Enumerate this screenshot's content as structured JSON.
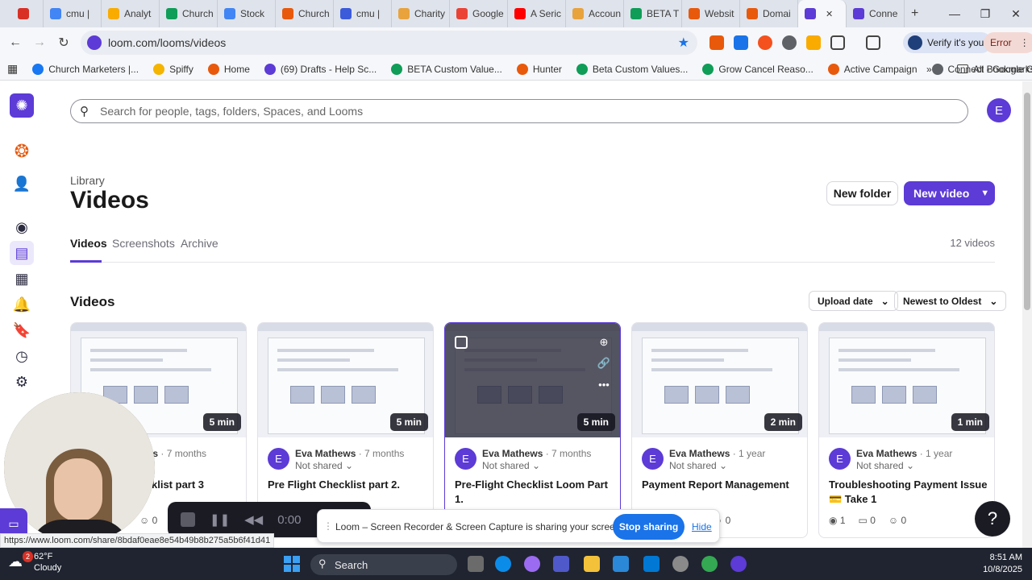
{
  "browser": {
    "tabs": [
      {
        "label": "",
        "color": "#d93025"
      },
      {
        "label": "cmu |",
        "color": "#4285f4"
      },
      {
        "label": "Analyt",
        "color": "#f9ab00"
      },
      {
        "label": "Church",
        "color": "#0f9d58"
      },
      {
        "label": "Stock",
        "color": "#4285f4"
      },
      {
        "label": "Church",
        "color": "#e8590c"
      },
      {
        "label": "cmu |",
        "color": "#3b5bdb"
      },
      {
        "label": "Charity",
        "color": "#e8a33d"
      },
      {
        "label": "Google",
        "color": "#ea4335"
      },
      {
        "label": "A Seric",
        "color": "#ff0000"
      },
      {
        "label": "Accoun",
        "color": "#e8a33d"
      },
      {
        "label": "BETA T",
        "color": "#0f9d58"
      },
      {
        "label": "Websit",
        "color": "#e8590c"
      },
      {
        "label": "Domai",
        "color": "#e8590c"
      },
      {
        "label": "",
        "color": "#5c3bd6"
      },
      {
        "label": "Conne",
        "color": "#5c3bd6"
      }
    ],
    "url": "loom.com/looms/videos",
    "verify_label": "Verify it's you",
    "error_label": "Error",
    "bookmarks": [
      {
        "label": "Church Marketers |...",
        "color": "#1877f2"
      },
      {
        "label": "Spiffy",
        "color": "#f4b400"
      },
      {
        "label": "Home",
        "color": "#e8590c"
      },
      {
        "label": "(69) Drafts - Help Sc...",
        "color": "#5c3bd6"
      },
      {
        "label": "BETA Custom Value...",
        "color": "#0f9d58"
      },
      {
        "label": "Hunter",
        "color": "#e8590c"
      },
      {
        "label": "Beta Custom Values...",
        "color": "#0f9d58"
      },
      {
        "label": "Grow Cancel Reaso...",
        "color": "#0f9d58"
      },
      {
        "label": "Active Campaign",
        "color": "#e8590c"
      },
      {
        "label": "Connect - Google G...",
        "color": "#5f6368"
      }
    ],
    "all_bookmarks": "All Bookmarks",
    "status_url": "https://www.loom.com/share/8bdaf0eae8e54b49b8b275a5b6f41d41"
  },
  "app": {
    "accent": "#5c3bd6",
    "search_placeholder": "Search for people, tags, folders, Spaces, and Looms",
    "avatar_initial": "E",
    "library_label": "Library",
    "page_title": "Videos",
    "new_folder": "New folder",
    "new_video": "New video",
    "tabs": [
      "Videos",
      "Screenshots",
      "Archive"
    ],
    "video_count": "12 videos",
    "section_title": "Videos",
    "sort_by": "Upload date",
    "sort_order": "Newest to Oldest",
    "videos": [
      {
        "title": "klist part 3",
        "author": "ws",
        "age": "· 7 months",
        "share": "",
        "duration": "5 min",
        "views": "",
        "comments": "",
        "reactions": "0"
      },
      {
        "title": "Pre Flight Checklist part 2.",
        "author": "Eva Mathews",
        "age": "· 7 months",
        "share": "Not shared",
        "duration": "5 min",
        "views": "",
        "comments": "",
        "reactions": ""
      },
      {
        "title": "Pre-Flight Checklist Loom Part 1.",
        "author": "Eva Mathews",
        "age": "· 7 months",
        "share": "Not shared",
        "duration": "5 min",
        "views": "",
        "comments": "",
        "reactions": ""
      },
      {
        "title": "Payment Report Management",
        "author": "Eva Mathews",
        "age": "· 1 year",
        "share": "Not shared",
        "duration": "2 min",
        "views": "",
        "comments": "",
        "reactions": "0"
      },
      {
        "title": "Troubleshooting Payment Issue 💳 Take 1",
        "author": "Eva Mathews",
        "age": "· 1 year",
        "share": "Not shared",
        "duration": "1 min",
        "views": "1",
        "comments": "0",
        "reactions": "0"
      }
    ]
  },
  "recorder": {
    "timer": "0:00",
    "share_message": "Loom – Screen Recorder & Screen Capture is sharing your screen and audio.",
    "stop_sharing": "Stop sharing",
    "hide": "Hide"
  },
  "taskbar": {
    "notification_count": "2",
    "temperature": "62°F",
    "weather": "Cloudy",
    "search_label": "Search",
    "time": "8:51 AM",
    "date": "10/8/2025"
  }
}
